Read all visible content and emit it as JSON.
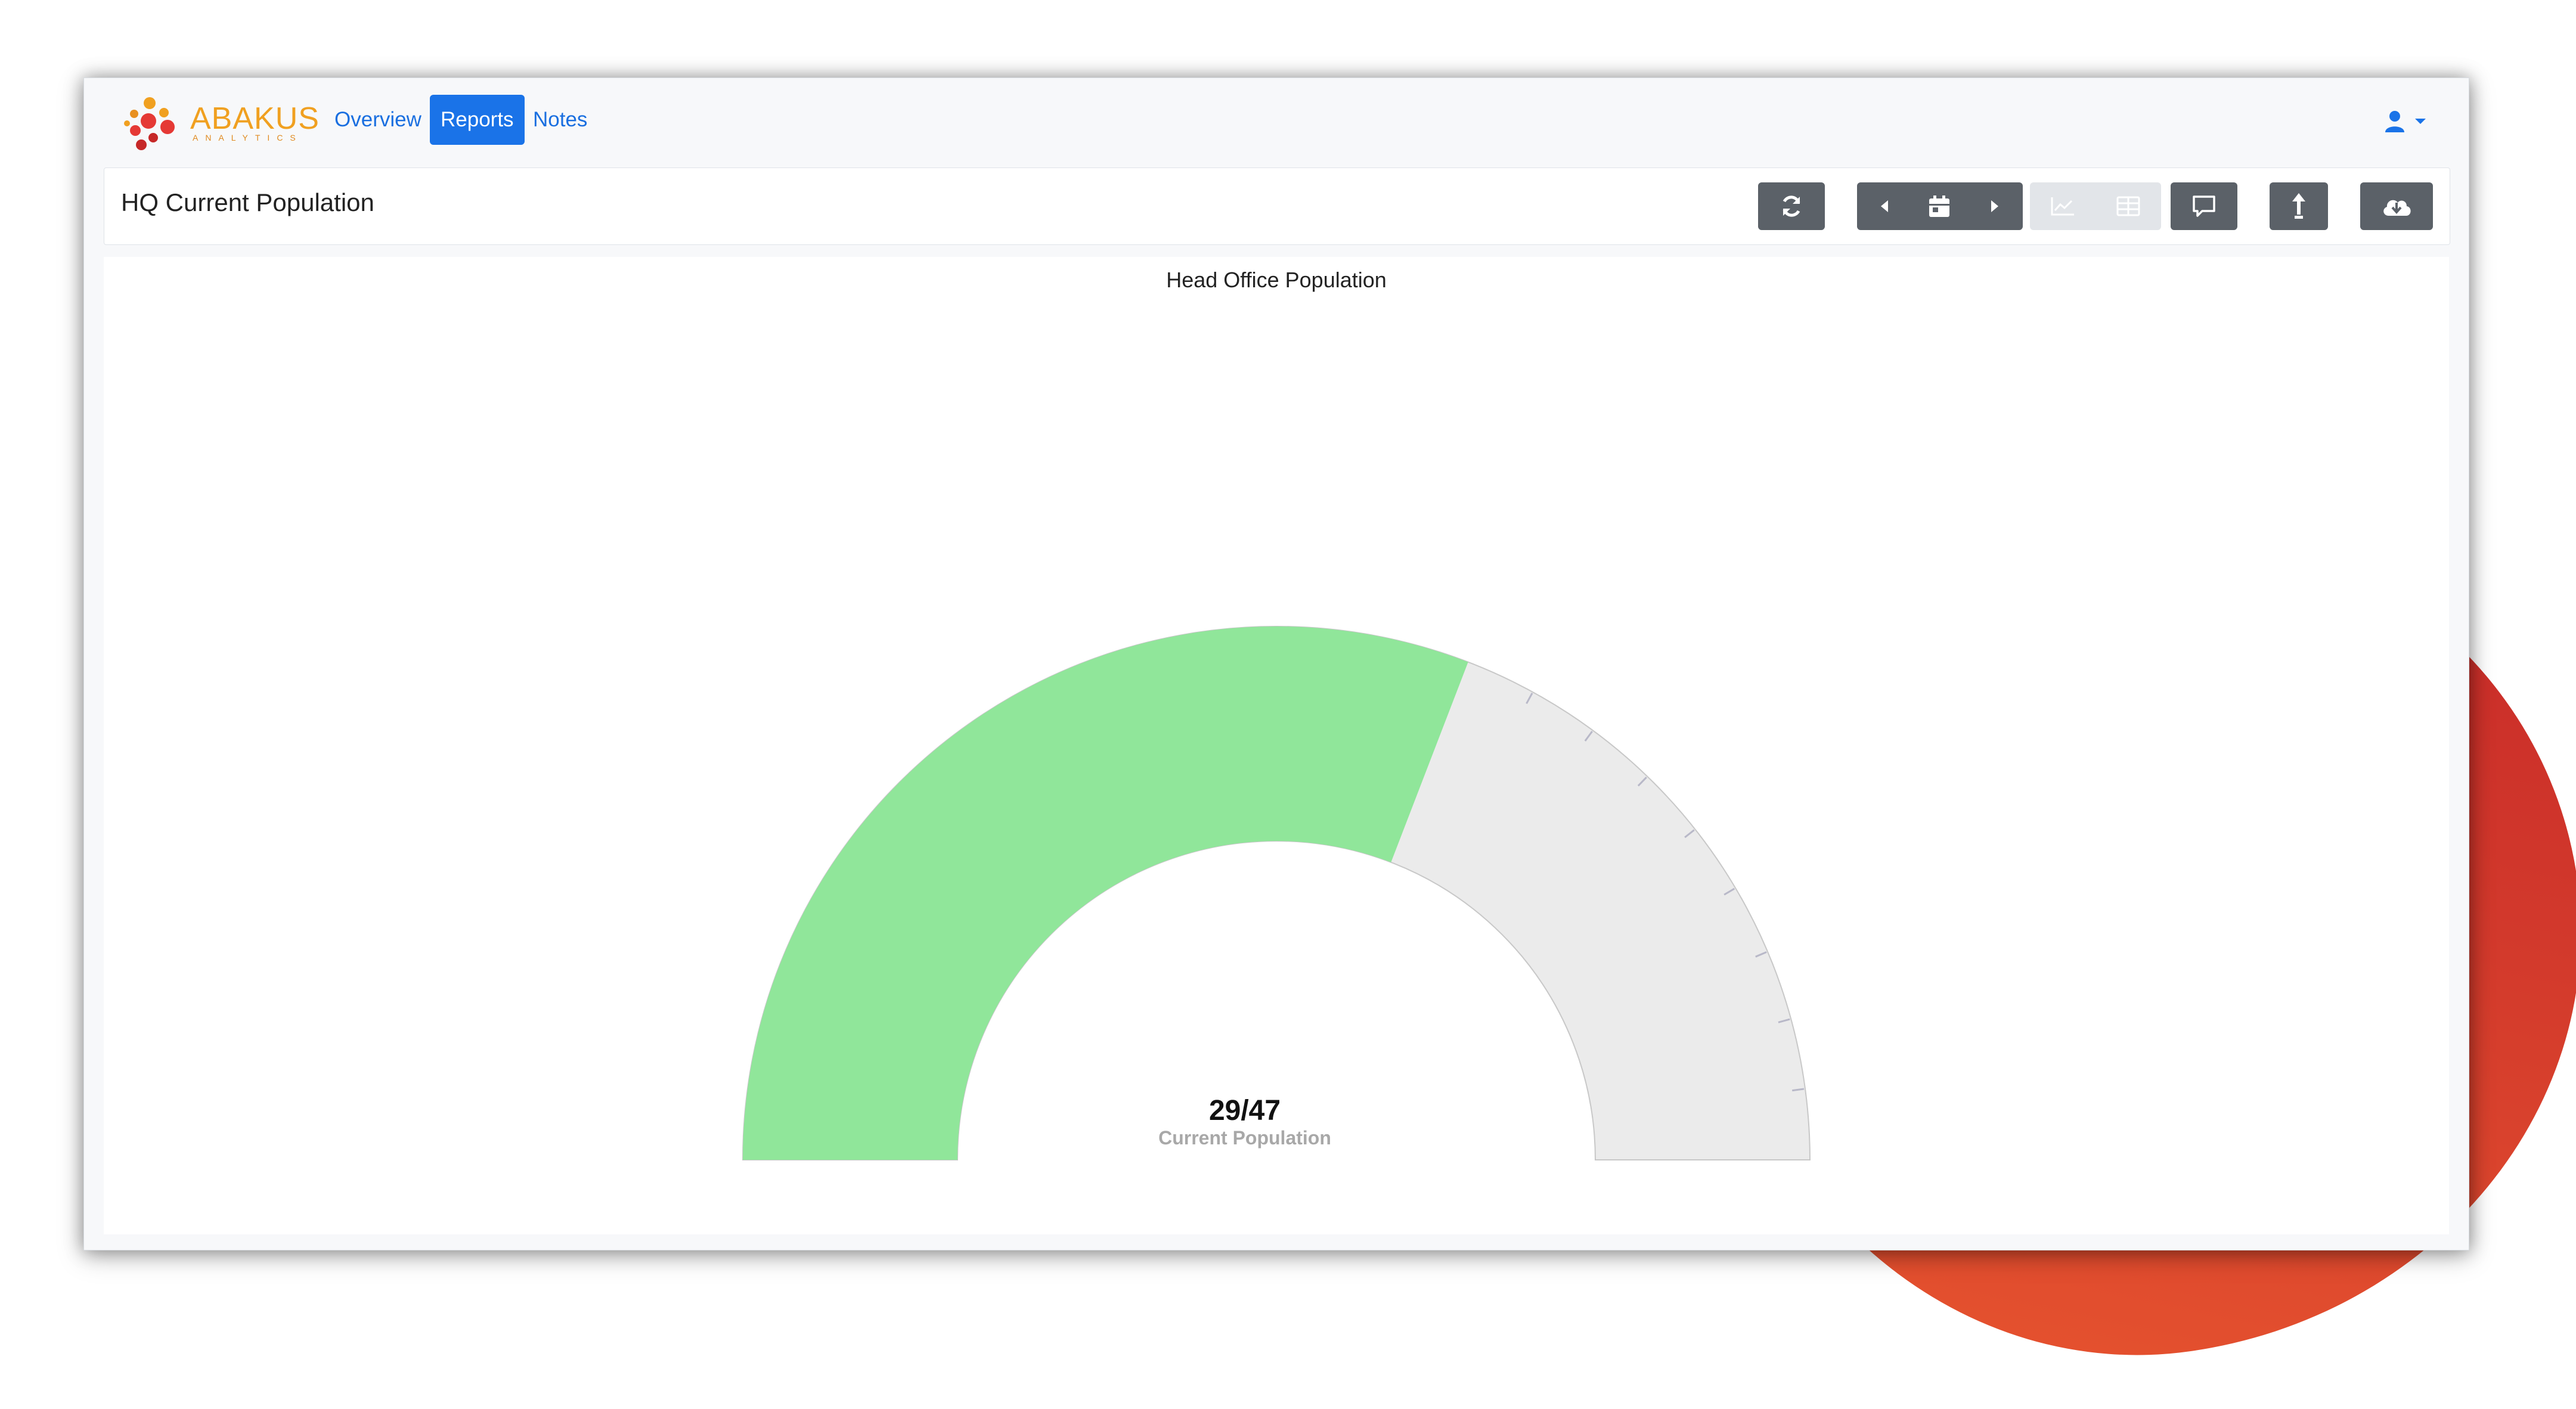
{
  "nav": {
    "logo_word": "ABAKUS",
    "logo_sub": "ANALYTICS",
    "links": [
      {
        "label": "Overview"
      },
      {
        "label": "Reports",
        "active": true
      },
      {
        "label": "Notes"
      }
    ],
    "user_icon": "user-icon"
  },
  "header": {
    "title": "HQ Current Population",
    "buttons": [
      "refresh-icon",
      "caret-left-icon",
      "calendar-icon",
      "caret-right-icon",
      "line-chart-icon",
      "table-icon",
      "comment-icon",
      "share-icon",
      "cloud-download-icon"
    ]
  },
  "chart_data": {
    "type": "gauge",
    "title": "Head Office Population",
    "value": 29,
    "max": 47,
    "value_text": "29/47",
    "label": "Current Population",
    "fill_color": "#90e69a",
    "track_color": "#ebebeb"
  },
  "colors": {
    "accent": "#1a73e8",
    "button": "#5b6168",
    "logo": "#f0a020"
  }
}
